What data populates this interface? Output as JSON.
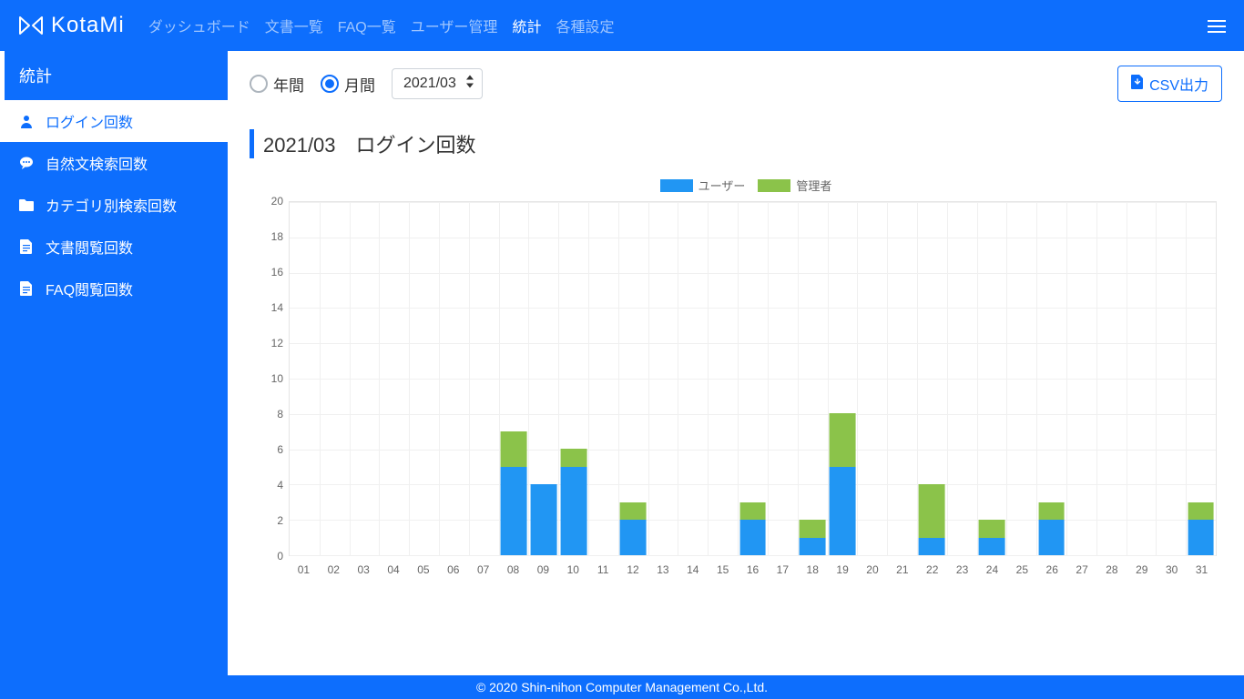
{
  "brand": "KotaMi",
  "nav": {
    "items": [
      {
        "label": "ダッシュボード",
        "active": false
      },
      {
        "label": "文書一覧",
        "active": false
      },
      {
        "label": "FAQ一覧",
        "active": false
      },
      {
        "label": "ユーザー管理",
        "active": false
      },
      {
        "label": "統計",
        "active": true
      },
      {
        "label": "各種設定",
        "active": false
      }
    ]
  },
  "sidebar": {
    "title": "統計",
    "items": [
      {
        "label": "ログイン回数",
        "icon": "user-icon",
        "active": true
      },
      {
        "label": "自然文検索回数",
        "icon": "comment-icon",
        "active": false
      },
      {
        "label": "カテゴリ別検索回数",
        "icon": "folder-icon",
        "active": false
      },
      {
        "label": "文書閲覧回数",
        "icon": "file-icon",
        "active": false
      },
      {
        "label": "FAQ閲覧回数",
        "icon": "file-icon",
        "active": false
      }
    ]
  },
  "controls": {
    "radio_year": "年間",
    "radio_month": "月間",
    "selected_period": "2021/03",
    "csv_label": "CSV出力"
  },
  "page_title": "2021/03　ログイン回数",
  "legend": {
    "user": "ユーザー",
    "admin": "管理者"
  },
  "colors": {
    "user": "#2196f3",
    "admin": "#8bc34a",
    "brand": "#0d6efd"
  },
  "chart_data": {
    "type": "bar",
    "title": "2021/03　ログイン回数",
    "xlabel": "",
    "ylabel": "",
    "ylim": [
      0,
      20
    ],
    "yticks": [
      0,
      2,
      4,
      6,
      8,
      10,
      12,
      14,
      16,
      18,
      20
    ],
    "categories": [
      "01",
      "02",
      "03",
      "04",
      "05",
      "06",
      "07",
      "08",
      "09",
      "10",
      "11",
      "12",
      "13",
      "14",
      "15",
      "16",
      "17",
      "18",
      "19",
      "20",
      "21",
      "22",
      "23",
      "24",
      "25",
      "26",
      "27",
      "28",
      "29",
      "30",
      "31"
    ],
    "series": [
      {
        "name": "ユーザー",
        "color": "#2196f3",
        "values": [
          0,
          0,
          0,
          0,
          0,
          0,
          0,
          5,
          4,
          5,
          0,
          2,
          0,
          0,
          0,
          2,
          0,
          1,
          5,
          0,
          0,
          1,
          0,
          1,
          0,
          2,
          0,
          0,
          0,
          0,
          2
        ]
      },
      {
        "name": "管理者",
        "color": "#8bc34a",
        "values": [
          0,
          0,
          0,
          0,
          0,
          0,
          0,
          2,
          0,
          1,
          0,
          1,
          0,
          0,
          0,
          1,
          0,
          1,
          3,
          0,
          0,
          3,
          0,
          1,
          0,
          1,
          0,
          0,
          0,
          0,
          1
        ]
      }
    ]
  },
  "footer": "© 2020 Shin-nihon Computer Management Co.,Ltd."
}
